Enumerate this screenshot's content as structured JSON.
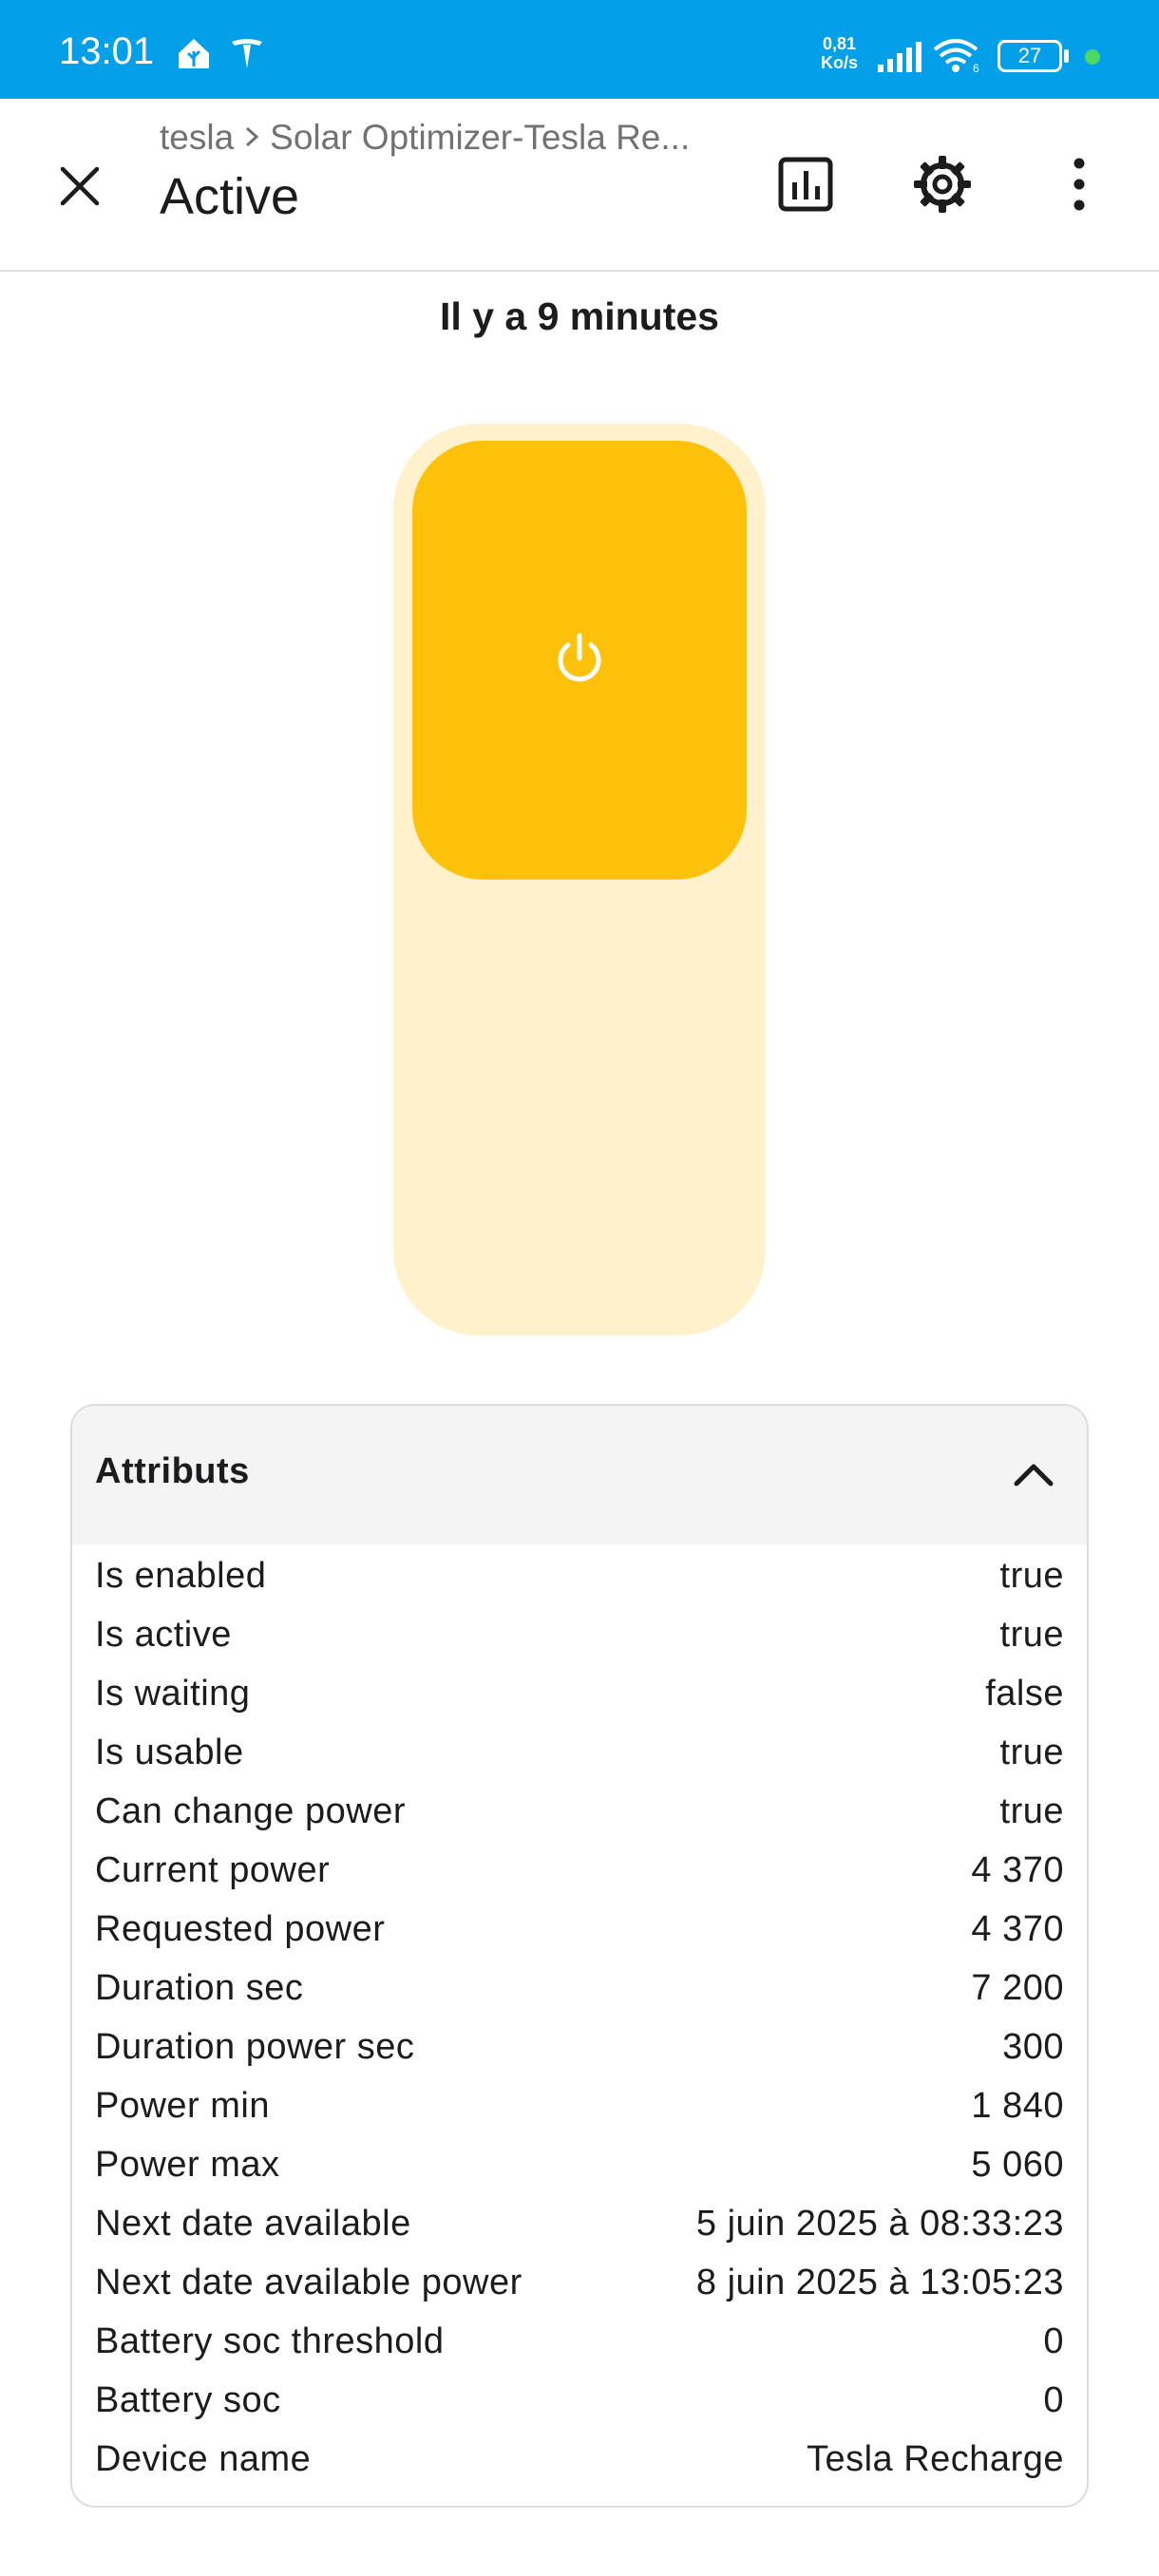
{
  "status_bar": {
    "time": "13:01",
    "speed_value": "0,81",
    "speed_unit": "Ko/s",
    "battery": "27",
    "icons": [
      "home-assistant-icon",
      "tesla-icon",
      "signal-icon",
      "wifi-icon",
      "battery-icon"
    ]
  },
  "header": {
    "breadcrumb": [
      "tesla",
      "Solar Optimizer-Tesla Re..."
    ],
    "title": "Active",
    "actions": [
      "history-icon",
      "settings-icon",
      "more-icon"
    ]
  },
  "last_changed": "Il y a 9 minutes",
  "toggle": {
    "state": "on",
    "on_color": "#fec10a",
    "track_color": "#fef1cc"
  },
  "attributes": {
    "title": "Attributs",
    "rows": [
      {
        "label": "Is enabled",
        "value": "true"
      },
      {
        "label": "Is active",
        "value": "true"
      },
      {
        "label": "Is waiting",
        "value": "false"
      },
      {
        "label": "Is usable",
        "value": "true"
      },
      {
        "label": "Can change power",
        "value": "true"
      },
      {
        "label": "Current power",
        "value": "4 370"
      },
      {
        "label": "Requested power",
        "value": "4 370"
      },
      {
        "label": "Duration sec",
        "value": "7 200"
      },
      {
        "label": "Duration power sec",
        "value": "300"
      },
      {
        "label": "Power min",
        "value": "1 840"
      },
      {
        "label": "Power max",
        "value": "5 060"
      },
      {
        "label": "Next date available",
        "value": "5 juin 2025 à 08:33:23"
      },
      {
        "label": "Next date available power",
        "value": "8 juin 2025 à 13:05:23"
      },
      {
        "label": "Battery soc threshold",
        "value": "0"
      },
      {
        "label": "Battery soc",
        "value": "0"
      },
      {
        "label": "Device name",
        "value": "Tesla Recharge"
      }
    ]
  },
  "colors": {
    "status_bar": "#03a0e9",
    "accent": "#fec10a"
  }
}
